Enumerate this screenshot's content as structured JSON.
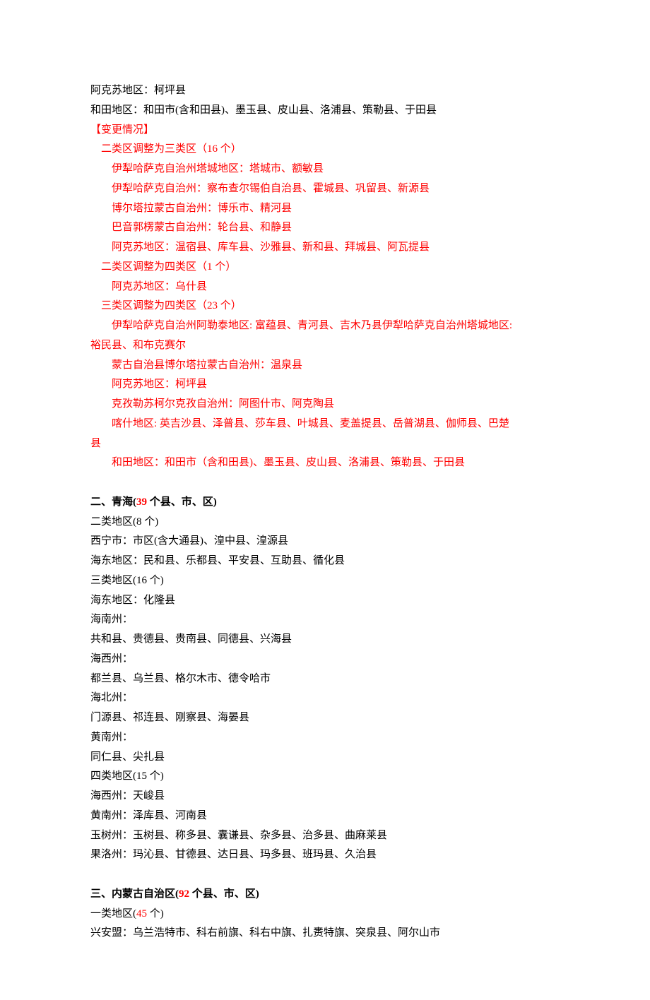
{
  "lines": [
    {
      "text": "阿克苏地区：柯坪县",
      "cls": ""
    },
    {
      "text": "和田地区：和田市(含和田县)、墨玉县、皮山县、洛浦县、策勒县、于田县",
      "cls": ""
    },
    {
      "text": "【变更情况】",
      "cls": "red"
    },
    {
      "text": "二类区调整为三类区（16 个）",
      "cls": "red ind1"
    },
    {
      "text": "伊犁哈萨克自治州塔城地区：塔城市、额敏县",
      "cls": "red ind2"
    },
    {
      "text": "伊犁哈萨克自治州：察布查尔锡伯自治县、霍城县、巩留县、新源县",
      "cls": "red ind2"
    },
    {
      "text": "博尔塔拉蒙古自治州：博乐市、精河县",
      "cls": "red ind2"
    },
    {
      "text": "巴音郭楞蒙古自治州：轮台县、和静县",
      "cls": "red ind2"
    },
    {
      "text": "阿克苏地区：温宿县、库车县、沙雅县、新和县、拜城县、阿瓦提县",
      "cls": "red ind2"
    },
    {
      "text": "二类区调整为四类区（1 个）",
      "cls": "red ind1"
    },
    {
      "text": "阿克苏地区：乌什县",
      "cls": "red ind2"
    },
    {
      "text": "三类区调整为四类区（23 个）",
      "cls": "red ind1"
    },
    {
      "text": "伊犁哈萨克自治州阿勒泰地区: 富蕴县、青河县、吉木乃县伊犁哈萨克自治州塔城地区:",
      "cls": "red ind2"
    },
    {
      "text": "裕民县、和布克赛尔",
      "cls": "red"
    },
    {
      "text": "蒙古自治县博尔塔拉蒙古自治州：温泉县",
      "cls": "red ind2"
    },
    {
      "text": "阿克苏地区：柯坪县",
      "cls": "red ind2"
    },
    {
      "text": "克孜勒苏柯尔克孜自治州：阿图什市、阿克陶县",
      "cls": "red ind2"
    },
    {
      "text": "喀什地区: 英吉沙县、泽普县、莎车县、叶城县、麦盖提县、岳普湖县、伽师县、巴楚",
      "cls": "red ind2"
    },
    {
      "text": "县",
      "cls": "red"
    },
    {
      "text": "和田地区：和田市（含和田县)、墨玉县、皮山县、洛浦县、策勒县、于田县",
      "cls": "red ind2"
    },
    {
      "type": "blank"
    },
    {
      "type": "composite",
      "parts": [
        {
          "t": "二、青海(",
          "cls": "bold"
        },
        {
          "t": "39",
          "cls": "bold red-num"
        },
        {
          "t": " 个县、市、区)",
          "cls": "bold"
        }
      ]
    },
    {
      "text": "二类地区(8 个)",
      "cls": ""
    },
    {
      "text": "西宁市：市区(含大通县)、湟中县、湟源县",
      "cls": ""
    },
    {
      "text": "海东地区：民和县、乐都县、平安县、互助县、循化县",
      "cls": ""
    },
    {
      "text": "三类地区(16 个)",
      "cls": ""
    },
    {
      "text": "海东地区：化隆县",
      "cls": ""
    },
    {
      "text": "海南州：",
      "cls": ""
    },
    {
      "text": "共和县、贵德县、贵南县、同德县、兴海县",
      "cls": ""
    },
    {
      "text": "海西州：",
      "cls": ""
    },
    {
      "text": "都兰县、乌兰县、格尔木市、德令哈市",
      "cls": ""
    },
    {
      "text": "海北州：",
      "cls": ""
    },
    {
      "text": "门源县、祁连县、刚察县、海晏县",
      "cls": ""
    },
    {
      "text": "黄南州：",
      "cls": ""
    },
    {
      "text": "同仁县、尖扎县",
      "cls": ""
    },
    {
      "text": "四类地区(15 个)",
      "cls": ""
    },
    {
      "text": "海西州：天峻县",
      "cls": ""
    },
    {
      "text": "黄南州：泽库县、河南县",
      "cls": ""
    },
    {
      "text": "玉树州：玉树县、称多县、囊谦县、杂多县、治多县、曲麻莱县",
      "cls": ""
    },
    {
      "text": "果洛州：玛沁县、甘德县、达日县、玛多县、班玛县、久治县",
      "cls": ""
    },
    {
      "type": "blank"
    },
    {
      "type": "composite",
      "parts": [
        {
          "t": "三、内蒙古自治区(",
          "cls": "bold"
        },
        {
          "t": "92",
          "cls": "bold red-num"
        },
        {
          "t": " 个县、市、区)",
          "cls": "bold"
        }
      ]
    },
    {
      "type": "composite",
      "parts": [
        {
          "t": "一类地区(",
          "cls": ""
        },
        {
          "t": "45",
          "cls": "red-num"
        },
        {
          "t": " 个)",
          "cls": ""
        }
      ]
    },
    {
      "text": "兴安盟：乌兰浩特市、科右前旗、科右中旗、扎赉特旗、突泉县、阿尔山市",
      "cls": ""
    }
  ]
}
